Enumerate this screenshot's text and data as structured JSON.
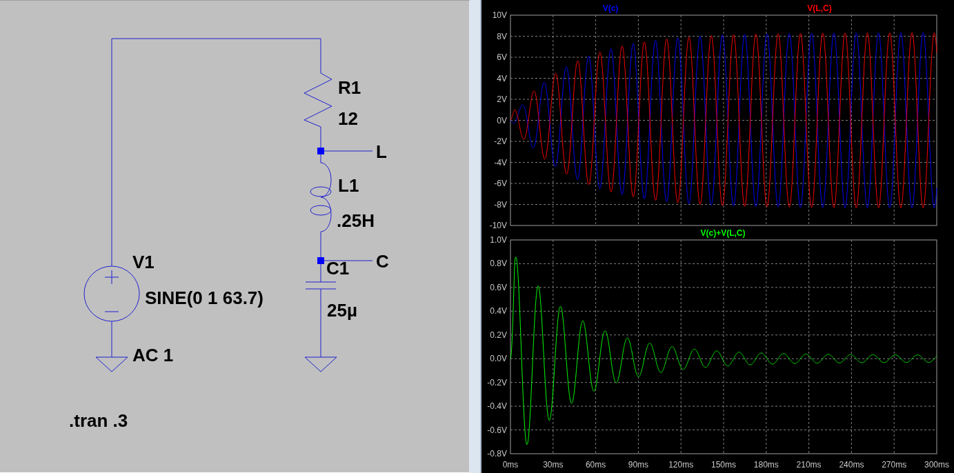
{
  "schematic": {
    "components": [
      {
        "kind": "resistor",
        "name": "R1",
        "value": "12"
      },
      {
        "kind": "inductor",
        "name": "L1",
        "value": ".25H"
      },
      {
        "kind": "source",
        "name": "V1",
        "value": "SINE(0 1 63.7)",
        "extra": "AC 1"
      },
      {
        "kind": "capacitor",
        "name": "C1",
        "value": "25µ"
      }
    ],
    "net_labels": [
      "L",
      "C"
    ],
    "directive": ".tran .3"
  },
  "waveform_viewer": {
    "plots": [
      {
        "traces": [
          {
            "label": "V(c)",
            "color": "#0000ff",
            "kind": "vc"
          },
          {
            "label": "V(L,C)",
            "color": "#ff0000",
            "kind": "vlc"
          }
        ],
        "yticks": [
          "10V",
          "8V",
          "6V",
          "4V",
          "2V",
          "0V",
          "-2V",
          "-4V",
          "-6V",
          "-8V",
          "-10V"
        ]
      },
      {
        "traces": [
          {
            "label": "V(c)+V(L,C)",
            "color": "#00ff00",
            "kind": "sum"
          }
        ],
        "yticks": [
          "1.0V",
          "0.8V",
          "0.6V",
          "0.4V",
          "0.2V",
          "0.0V",
          "-0.2V",
          "-0.4V",
          "-0.6V",
          "-0.8V"
        ]
      }
    ],
    "xticks": [
      "0ms",
      "30ms",
      "60ms",
      "90ms",
      "120ms",
      "150ms",
      "180ms",
      "210ms",
      "240ms",
      "270ms",
      "300ms"
    ]
  }
}
